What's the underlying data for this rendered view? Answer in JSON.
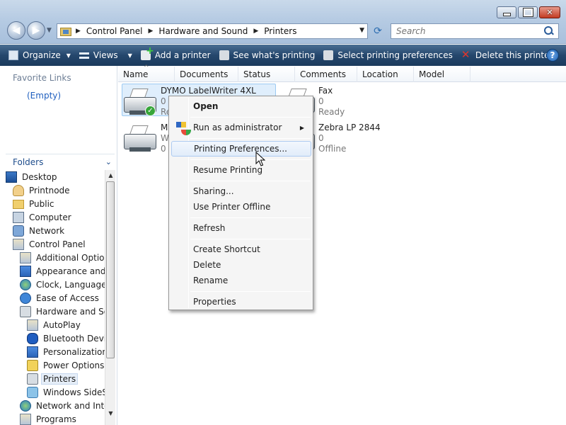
{
  "window": {
    "address": {
      "crumbs": [
        "Control Panel",
        "Hardware and Sound",
        "Printers"
      ]
    },
    "search": {
      "placeholder": "Search"
    }
  },
  "toolbar": {
    "organize": "Organize",
    "views": "Views",
    "add_printer": "Add a printer",
    "see_printing": "See what's printing",
    "select_prefs": "Select printing preferences",
    "delete_printer": "Delete this printer",
    "more": "»"
  },
  "left_pane": {
    "favorite_links_title": "Favorite Links",
    "favorite_links_empty": "(Empty)",
    "folders_title": "Folders",
    "tree": [
      {
        "label": "Desktop",
        "icon": "desktop-icon"
      },
      {
        "label": "Printnode",
        "icon": "user-folder-icon"
      },
      {
        "label": "Public",
        "icon": "folder-icon"
      },
      {
        "label": "Computer",
        "icon": "computer-icon"
      },
      {
        "label": "Network",
        "icon": "network-icon"
      },
      {
        "label": "Control Panel",
        "icon": "control-panel-icon"
      },
      {
        "label": "Additional Options",
        "icon": "options-icon"
      },
      {
        "label": "Appearance and P",
        "icon": "appearance-icon"
      },
      {
        "label": "Clock, Language, a",
        "icon": "clock-icon"
      },
      {
        "label": "Ease of Access",
        "icon": "ease-of-access-icon"
      },
      {
        "label": "Hardware and Sou",
        "icon": "hardware-icon"
      },
      {
        "label": "AutoPlay",
        "icon": "autoplay-icon"
      },
      {
        "label": "Bluetooth Device",
        "icon": "bluetooth-icon"
      },
      {
        "label": "Personalization",
        "icon": "personalization-icon"
      },
      {
        "label": "Power Options",
        "icon": "power-icon"
      },
      {
        "label": "Printers",
        "icon": "printer-icon"
      },
      {
        "label": "Windows SideSh",
        "icon": "sideshow-icon"
      },
      {
        "label": "Network and Inter",
        "icon": "network-internet-icon"
      },
      {
        "label": "Programs",
        "icon": "programs-icon"
      }
    ]
  },
  "columns": [
    "Name",
    "Documents",
    "Status",
    "Comments",
    "Location",
    "Model"
  ],
  "printers": [
    {
      "name": "DYMO LabelWriter 4XL",
      "docs": "0",
      "status": "Re"
    },
    {
      "name": "M",
      "docs": "0",
      "status": "W"
    },
    {
      "name": "Fax",
      "docs": "0",
      "status": "Ready"
    },
    {
      "name": "Zebra LP 2844",
      "docs": "0",
      "status": "Offline"
    }
  ],
  "context_menu": {
    "open": "Open",
    "run_admin": "Run as administrator",
    "printing_prefs": "Printing Preferences...",
    "resume": "Resume Printing",
    "sharing": "Sharing...",
    "use_offline": "Use Printer Offline",
    "refresh": "Refresh",
    "create_shortcut": "Create Shortcut",
    "delete": "Delete",
    "rename": "Rename",
    "properties": "Properties"
  }
}
